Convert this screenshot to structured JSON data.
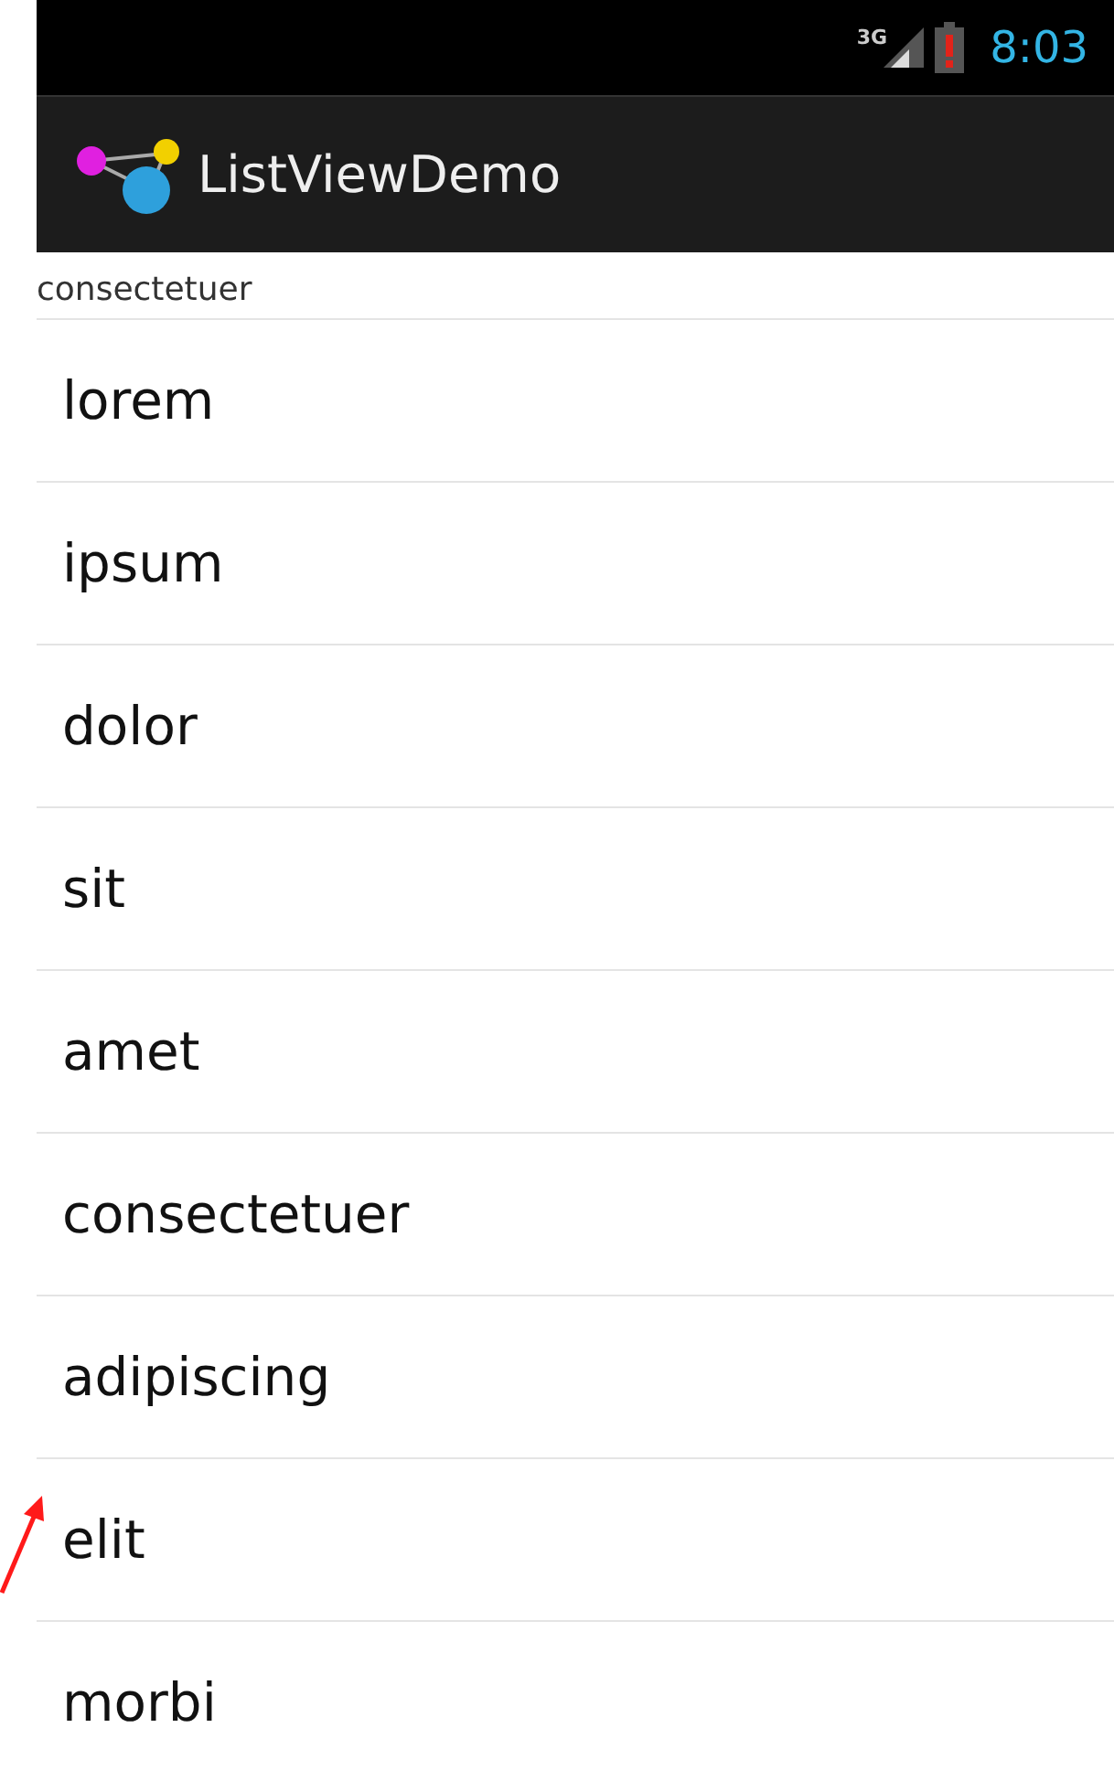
{
  "status_bar": {
    "network": "3G",
    "time": "8:03"
  },
  "action_bar": {
    "title": "ListViewDemo"
  },
  "selection_label": "consectetuer",
  "list": {
    "items": [
      {
        "label": "lorem"
      },
      {
        "label": "ipsum"
      },
      {
        "label": "dolor"
      },
      {
        "label": "sit"
      },
      {
        "label": "amet"
      },
      {
        "label": "consectetuer"
      },
      {
        "label": "adipiscing"
      },
      {
        "label": "elit"
      },
      {
        "label": "morbi"
      }
    ]
  }
}
